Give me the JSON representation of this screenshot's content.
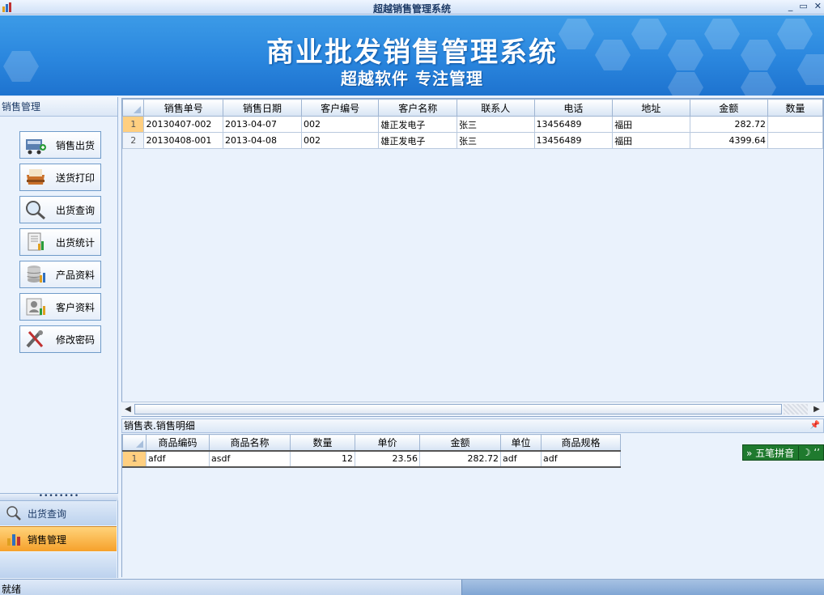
{
  "window": {
    "title": "超越销售管理系统",
    "minimize_icon": "minimize-icon",
    "restore_icon": "restore-icon",
    "close_icon": "close-icon"
  },
  "banner": {
    "title": "商业批发销售管理系统",
    "subtitle": "超越软件 专注管理"
  },
  "sidebar": {
    "header": "销售管理",
    "buttons": [
      {
        "label": "销售出货",
        "icon": "cart-icon"
      },
      {
        "label": "送货打印",
        "icon": "tray-icon"
      },
      {
        "label": "出货查询",
        "icon": "magnifier-icon"
      },
      {
        "label": "出货统计",
        "icon": "report-chart-icon"
      },
      {
        "label": "产品资料",
        "icon": "database-icon"
      },
      {
        "label": "客户资料",
        "icon": "contact-card-icon"
      },
      {
        "label": "修改密码",
        "icon": "tools-icon"
      }
    ],
    "grip": "••••••••",
    "nav": [
      {
        "label": "出货查询",
        "icon": "magnifier-icon",
        "active": false
      },
      {
        "label": "销售管理",
        "icon": "bar-chart-icon",
        "active": true
      }
    ]
  },
  "main_grid": {
    "columns": [
      "销售单号",
      "销售日期",
      "客户编号",
      "客户名称",
      "联系人",
      "电话",
      "地址",
      "金额",
      "数量"
    ],
    "rows": [
      {
        "num": "1",
        "cells": [
          "20130407-002",
          "2013-04-07",
          "002",
          "雄正发电子",
          "张三",
          "13456489",
          "福田",
          "282.72",
          ""
        ]
      },
      {
        "num": "2",
        "cells": [
          "20130408-001",
          "2013-04-08",
          "002",
          "雄正发电子",
          "张三",
          "13456489",
          "福田",
          "4399.64",
          ""
        ]
      }
    ]
  },
  "detail": {
    "caption": "销售表.销售明细",
    "pin": "ᵖ",
    "columns": [
      "商品编码",
      "商品名称",
      "数量",
      "单价",
      "金额",
      "单位",
      "商品规格"
    ],
    "rows": [
      {
        "num": "1",
        "cells": [
          "afdf",
          "asdf",
          "12",
          "23.56",
          "282.72",
          "adf",
          "adf"
        ]
      }
    ]
  },
  "ime": {
    "label": "五笔拼音",
    "mode": "☽ ʻʼ"
  },
  "status": {
    "text": "就绪"
  }
}
